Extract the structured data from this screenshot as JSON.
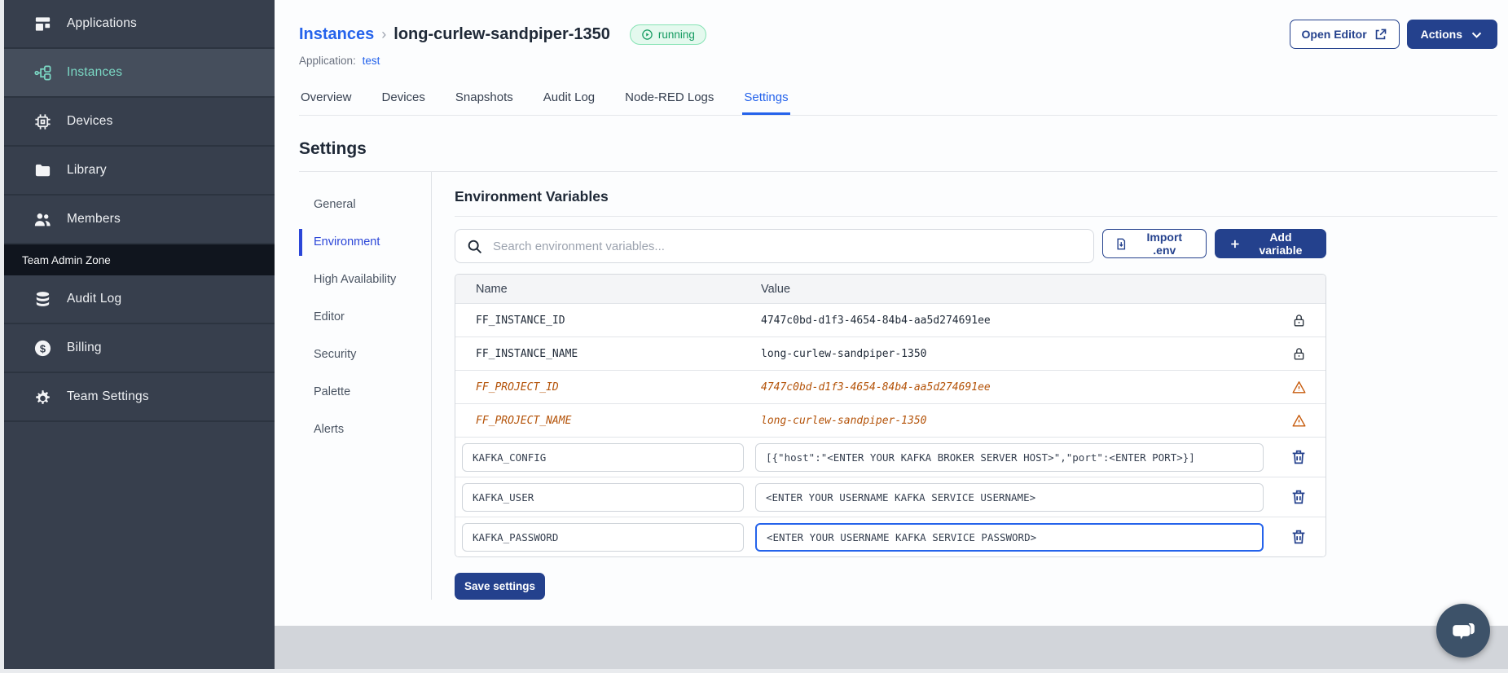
{
  "sidebar": {
    "main_items": [
      {
        "label": "Applications",
        "icon": "applications-icon",
        "active": false
      },
      {
        "label": "Instances",
        "icon": "instances-icon",
        "active": true
      },
      {
        "label": "Devices",
        "icon": "devices-icon",
        "active": false
      },
      {
        "label": "Library",
        "icon": "library-icon",
        "active": false
      },
      {
        "label": "Members",
        "icon": "members-icon",
        "active": false
      }
    ],
    "section_label": "Team Admin Zone",
    "admin_items": [
      {
        "label": "Audit Log",
        "icon": "audit-log-icon",
        "active": false
      },
      {
        "label": "Billing",
        "icon": "billing-icon",
        "active": false
      },
      {
        "label": "Team Settings",
        "icon": "team-settings-icon",
        "active": false
      }
    ]
  },
  "header": {
    "breadcrumb_root": "Instances",
    "breadcrumb_separator": "›",
    "instance_name": "long-curlew-sandpiper-1350",
    "status_badge": "running",
    "application_label": "Application:",
    "application_name": "test",
    "open_editor_label": "Open Editor",
    "actions_label": "Actions"
  },
  "tabs": [
    {
      "label": "Overview",
      "active": false
    },
    {
      "label": "Devices",
      "active": false
    },
    {
      "label": "Snapshots",
      "active": false
    },
    {
      "label": "Audit Log",
      "active": false
    },
    {
      "label": "Node-RED Logs",
      "active": false
    },
    {
      "label": "Settings",
      "active": true
    }
  ],
  "settings": {
    "page_title": "Settings",
    "nav": [
      {
        "label": "General",
        "active": false
      },
      {
        "label": "Environment",
        "active": true
      },
      {
        "label": "High Availability",
        "active": false
      },
      {
        "label": "Editor",
        "active": false
      },
      {
        "label": "Security",
        "active": false
      },
      {
        "label": "Palette",
        "active": false
      },
      {
        "label": "Alerts",
        "active": false
      }
    ],
    "section_title": "Environment Variables",
    "search_placeholder": "Search environment variables...",
    "import_button_label": "Import .env",
    "add_button_label": "Add variable",
    "save_button_label": "Save settings",
    "table": {
      "columns": [
        "Name",
        "Value"
      ],
      "rows": [
        {
          "name": "FF_INSTANCE_ID",
          "value": "4747c0bd-d1f3-4654-84b4-aa5d274691ee",
          "state": "locked",
          "icon": "lock-icon",
          "focused": false
        },
        {
          "name": "FF_INSTANCE_NAME",
          "value": "long-curlew-sandpiper-1350",
          "state": "locked",
          "icon": "lock-icon",
          "focused": false
        },
        {
          "name": "FF_PROJECT_ID",
          "value": "4747c0bd-d1f3-4654-84b4-aa5d274691ee",
          "state": "deprecated",
          "icon": "warning-icon",
          "focused": false
        },
        {
          "name": "FF_PROJECT_NAME",
          "value": "long-curlew-sandpiper-1350",
          "state": "deprecated",
          "icon": "warning-icon",
          "focused": false
        },
        {
          "name": "KAFKA_CONFIG",
          "value": "[{\"host\":\"<ENTER YOUR KAFKA BROKER SERVER HOST>\",\"port\":<ENTER PORT>}]",
          "state": "editable",
          "icon": "trash-icon",
          "focused": false
        },
        {
          "name": "KAFKA_USER",
          "value": "<ENTER YOUR USERNAME KAFKA SERVICE USERNAME>",
          "state": "editable",
          "icon": "trash-icon",
          "focused": false
        },
        {
          "name": "KAFKA_PASSWORD",
          "value": "<ENTER YOUR USERNAME KAFKA SERVICE PASSWORD>",
          "state": "editable",
          "icon": "trash-icon",
          "focused": true
        }
      ]
    }
  },
  "widgets": {
    "chat_bubble_icon": "chat-icon"
  },
  "colors": {
    "sidebar_bg": "#373f4d",
    "sidebar_active_bg": "#454e5c",
    "sidebar_teal": "#7bd8c4",
    "admin_zone_bg": "#10151e",
    "primary_navy": "#24418d",
    "link_blue": "#2563eb",
    "active_nav_blue": "#2b46d8",
    "status_green": "#149a60",
    "status_green_bg": "#e4f9ee",
    "warning_orange": "#c75c0e",
    "deprecated_text": "#b45309",
    "footer_gray": "#d2d5da",
    "chat_circle": "#3d5269"
  }
}
